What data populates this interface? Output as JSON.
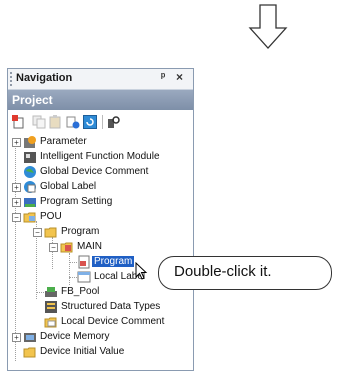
{
  "navigation": {
    "title": "Navigation",
    "pin_symbol": "ᵖ",
    "close_symbol": "×",
    "project_label": "Project",
    "toolbar_icons": [
      "new-data-icon",
      "copy-icon",
      "paste-icon",
      "properties-icon",
      "refresh-icon",
      "find-icon"
    ],
    "tree": {
      "parameter": "Parameter",
      "intelligent_function_module": "Intelligent Function Module",
      "global_device_comment": "Global Device Comment",
      "global_label": "Global Label",
      "program_setting": "Program Setting",
      "pou": "POU",
      "program_folder": "Program",
      "main": "MAIN",
      "program_selected": "Program",
      "local_label": "Local Label",
      "fb_pool": "FB_Pool",
      "structured_data_types": "Structured Data Types",
      "local_device_comment": "Local Device Comment",
      "device_memory": "Device Memory",
      "device_initial_value": "Device Initial Value"
    }
  },
  "callout": {
    "text": "Double-click it."
  }
}
